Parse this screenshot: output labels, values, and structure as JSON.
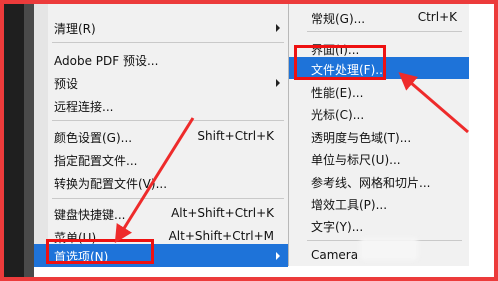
{
  "menu": {
    "clear": "清理(R)",
    "adobe_pdf": "Adobe PDF 预设...",
    "presets": "预设",
    "remote": "远程连接...",
    "color_settings": "颜色设置(G)...",
    "color_settings_sc": "Shift+Ctrl+K",
    "assign_profile": "指定配置文件...",
    "convert_profile": "转换为配置文件(V)...",
    "keyboard": "键盘快捷键...",
    "keyboard_sc": "Alt+Shift+Ctrl+K",
    "menus": "菜单(U)...",
    "menus_sc": "Alt+Shift+Ctrl+M",
    "preferences": "首选项(N)"
  },
  "submenu": {
    "general": "常规(G)...",
    "general_sc": "Ctrl+K",
    "interface": "界面(I)...",
    "file_handling": "文件处理(F)...",
    "performance": "性能(E)...",
    "cursors": "光标(C)...",
    "transparency": "透明度与色域(T)...",
    "units": "单位与标尺(U)...",
    "guides": "参考线、网格和切片...",
    "plugins": "增效工具(P)...",
    "type": "文字(Y)...",
    "camera_raw": "Camera"
  },
  "colors": {
    "highlight": "#1e73d9",
    "annotation_red": "#e11"
  }
}
